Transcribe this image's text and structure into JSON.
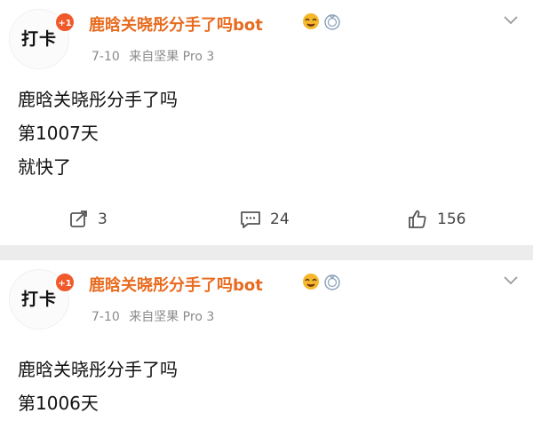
{
  "posts": [
    {
      "avatar_text": "打卡",
      "badge": "+1",
      "username": "鹿晗关晓彤分手了吗bot",
      "date": "7-10",
      "source": "来自坚果 Pro 3",
      "lines": [
        "鹿晗关晓彤分手了吗",
        "第1007天",
        "就快了"
      ],
      "reposts": "3",
      "comments": "24",
      "likes": "156"
    },
    {
      "avatar_text": "打卡",
      "badge": "+1",
      "username": "鹿晗关晓彤分手了吗bot",
      "date": "7-10",
      "source": "来自坚果 Pro 3",
      "lines": [
        "鹿晗关晓彤分手了吗",
        "第1006天"
      ]
    }
  ],
  "colors": {
    "username": "#e86b1f",
    "badge": "#f05a2b",
    "meta": "#8a8a8a"
  },
  "icons": [
    "repost-icon",
    "comment-icon",
    "like-icon",
    "expand-caret-icon",
    "emoji-face-icon",
    "emoji-medal-icon"
  ]
}
